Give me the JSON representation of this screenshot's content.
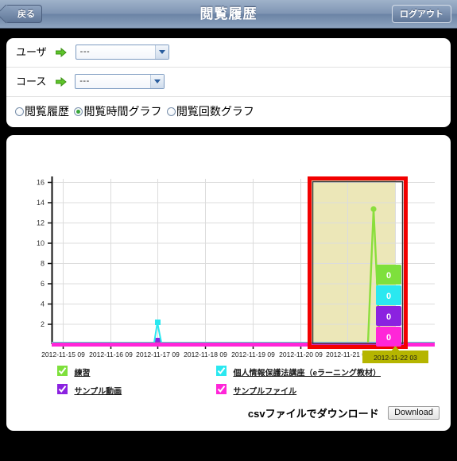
{
  "header": {
    "back_label": "戻る",
    "title": "閲覧履歴",
    "logout_label": "ログアウト"
  },
  "form": {
    "user_label": "ユーザ",
    "user_value": "---",
    "course_label": "コース",
    "course_value": "---",
    "radios": [
      {
        "label": "閲覧履歴",
        "checked": false
      },
      {
        "label": "閲覧時間グラフ",
        "checked": true
      },
      {
        "label": "閲覧回数グラフ",
        "checked": false
      }
    ]
  },
  "chart_data": {
    "type": "line",
    "title": "",
    "xlabel": "",
    "ylabel": "",
    "ylim": [
      0,
      16
    ],
    "yticks": [
      0,
      2,
      4,
      6,
      8,
      10,
      12,
      14,
      16
    ],
    "ytick_labels": [
      "",
      "2",
      "4",
      "6",
      "8",
      "10",
      "12",
      "14",
      "16"
    ],
    "grid": true,
    "legend_position": "below",
    "x": [
      "2012-11-15 09",
      "2012-11-16 09",
      "2012-11-17 09",
      "2012-11-18 09",
      "2012-11-19 09",
      "2012-11-20 09",
      "2012-11-21 09",
      "2012-11-22 03"
    ],
    "xtick_labels": [
      "2012-11-15 09",
      "2012-11-16 09",
      "2012-11-17 09",
      "2012-11-18 09",
      "2012-11-19 09",
      "2012-11-20 09",
      "2012-11-21 09"
    ],
    "highlighted_xtick_label": "2012-11-22 03",
    "series": [
      {
        "name": "練習",
        "color": "#7ee03c",
        "values": [
          0,
          0,
          0,
          0,
          0,
          0,
          0,
          13.3
        ]
      },
      {
        "name": "個人情報保護法講座（eラーニング教材）",
        "color": "#2ae8f0",
        "values": [
          0,
          0,
          2.1,
          0,
          0,
          0,
          0,
          0
        ]
      },
      {
        "name": "サンプル動画",
        "color": "#8b22e0",
        "values": [
          0,
          0,
          0.15,
          0,
          0,
          0,
          0,
          0
        ]
      },
      {
        "name": "サンプルファイル",
        "color": "#ff26d8",
        "values": [
          0,
          0,
          0,
          0,
          0,
          0,
          0,
          0
        ]
      }
    ],
    "selection": {
      "label": "selection-rectangle",
      "color": "#f20000",
      "fill": "#ece7b8",
      "from": "2012-11-21 09",
      "to": "2012-11-22 03"
    },
    "tooltip": {
      "date_label": "2012-11-22 03",
      "date_bg": "#b5b500",
      "entries": [
        {
          "value": "0",
          "color": "#7ee03c"
        },
        {
          "value": "0",
          "color": "#2ae8f0"
        },
        {
          "value": "0",
          "color": "#8b22e0"
        },
        {
          "value": "0",
          "color": "#ff26d8"
        }
      ]
    }
  },
  "legend": [
    {
      "label": "練習",
      "color": "#7ee03c",
      "checked": true
    },
    {
      "label": "個人情報保護法講座（eラーニング教材）",
      "color": "#2ae8f0",
      "checked": true
    },
    {
      "label": "サンプル動画",
      "color": "#8b22e0",
      "checked": true
    },
    {
      "label": "サンプルファイル",
      "color": "#ff26d8",
      "checked": true
    }
  ],
  "download": {
    "text": "csvファイルでダウンロード",
    "button_label": "Download"
  }
}
